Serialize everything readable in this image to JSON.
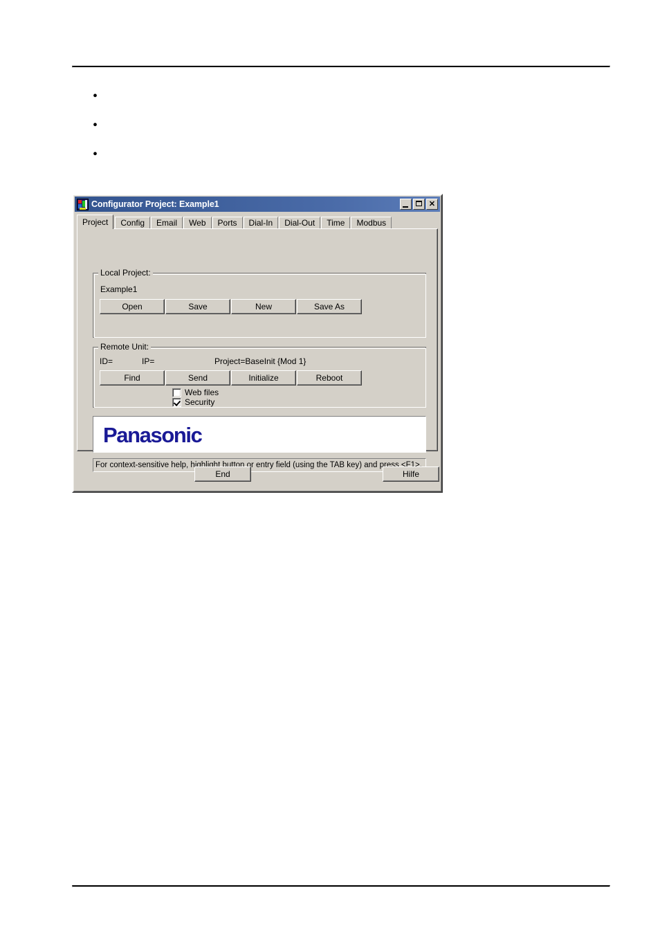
{
  "document": {
    "bullets": [
      "",
      "",
      ""
    ]
  },
  "dialog": {
    "title": "Configurator Project: Example1",
    "icon": "app-icon",
    "window_controls": {
      "minimize": "_",
      "maximize": "□",
      "close": "✕"
    },
    "tabs": [
      {
        "label": "Project",
        "active": true
      },
      {
        "label": "Config",
        "active": false
      },
      {
        "label": "Email",
        "active": false
      },
      {
        "label": "Web",
        "active": false
      },
      {
        "label": "Ports",
        "active": false
      },
      {
        "label": "Dial-In",
        "active": false
      },
      {
        "label": "Dial-Out",
        "active": false
      },
      {
        "label": "Time",
        "active": false
      },
      {
        "label": "Modbus",
        "active": false
      }
    ],
    "local_project": {
      "legend": "Local Project:",
      "project_name": "Example1",
      "buttons": [
        {
          "label": "Open"
        },
        {
          "label": "Save"
        },
        {
          "label": "New"
        },
        {
          "label": "Save As"
        }
      ]
    },
    "remote_unit": {
      "legend": "Remote Unit:",
      "id_label": "ID=",
      "ip_label": "IP=",
      "project_label": "Project=BaseInit   {Mod 1}",
      "buttons": [
        {
          "label": "Find"
        },
        {
          "label": "Send"
        },
        {
          "label": "Initialize"
        },
        {
          "label": "Reboot"
        }
      ],
      "checkboxes": [
        {
          "label": "Web files",
          "checked": false
        },
        {
          "label": "Security",
          "checked": true
        }
      ]
    },
    "logo": {
      "text": "Panasonic",
      "color": "#1a1a96"
    },
    "status_bar": {
      "text": "For context-sensitive help, highlight button or entry field (using the TAB key) and press <F1>."
    },
    "footer": {
      "end_label": "End",
      "help_label": "Hilfe"
    },
    "colors": {
      "face": "#d4d0c8",
      "title_bar": "#33548f",
      "shadow": "#808080",
      "dark_shadow": "#404040",
      "highlight": "#ffffff"
    }
  }
}
